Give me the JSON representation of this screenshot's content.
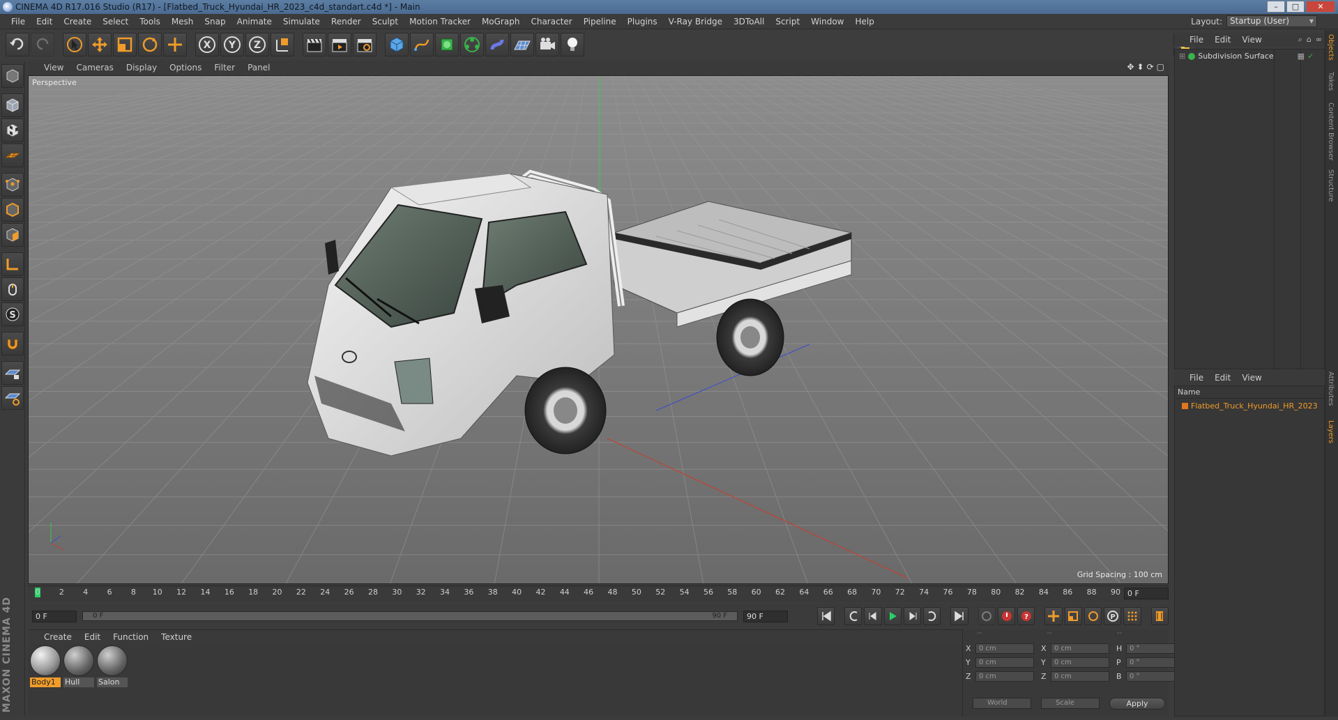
{
  "window": {
    "title": "CINEMA 4D R17.016 Studio (R17) - [Flatbed_Truck_Hyundai_HR_2023_c4d_standart.c4d *] - Main",
    "minimize": "–",
    "maximize": "□",
    "close": "✕"
  },
  "menubar": [
    "File",
    "Edit",
    "Create",
    "Select",
    "Tools",
    "Mesh",
    "Snap",
    "Animate",
    "Simulate",
    "Render",
    "Sculpt",
    "Motion Tracker",
    "MoGraph",
    "Character",
    "Pipeline",
    "Plugins",
    "V-Ray Bridge",
    "3DToAll",
    "Script",
    "Window",
    "Help"
  ],
  "layout": {
    "label": "Layout:",
    "value": "Startup (User)"
  },
  "viewport": {
    "menu": [
      "View",
      "Cameras",
      "Display",
      "Options",
      "Filter",
      "Panel"
    ],
    "label": "Perspective",
    "grid_spacing": "Grid Spacing : 100 cm"
  },
  "timeline": {
    "ticks": [
      "0",
      "2",
      "4",
      "6",
      "8",
      "10",
      "12",
      "14",
      "16",
      "18",
      "20",
      "22",
      "24",
      "26",
      "28",
      "30",
      "32",
      "34",
      "36",
      "38",
      "40",
      "42",
      "44",
      "46",
      "48",
      "50",
      "52",
      "54",
      "56",
      "58",
      "60",
      "62",
      "64",
      "66",
      "68",
      "70",
      "72",
      "74",
      "76",
      "78",
      "80",
      "82",
      "84",
      "86",
      "88",
      "90"
    ],
    "current_frame": "0 F"
  },
  "transport": {
    "start": "0 F",
    "range_start": "0 F",
    "range_end": "90 F",
    "end": "90 F"
  },
  "materials": {
    "menu": [
      "Create",
      "Edit",
      "Function",
      "Texture"
    ],
    "items": [
      {
        "name": "Body1",
        "selected": true
      },
      {
        "name": "Hull",
        "selected": false
      },
      {
        "name": "Salon",
        "selected": false
      }
    ]
  },
  "coords": {
    "header": [
      "--",
      "--",
      "--"
    ],
    "rows": [
      {
        "a": "X",
        "av": "0 cm",
        "b": "X",
        "bv": "0 cm",
        "c": "H",
        "cv": "0 °"
      },
      {
        "a": "Y",
        "av": "0 cm",
        "b": "Y",
        "bv": "0 cm",
        "c": "P",
        "cv": "0 °"
      },
      {
        "a": "Z",
        "av": "0 cm",
        "b": "Z",
        "bv": "0 cm",
        "c": "B",
        "cv": "0 °"
      }
    ],
    "world": "World",
    "scale": "Scale",
    "apply": "Apply"
  },
  "objects": {
    "menu": [
      "File",
      "Edit",
      "View"
    ],
    "items": [
      {
        "name": "Subdivision Surface"
      }
    ]
  },
  "layers": {
    "menu": [
      "File",
      "Edit",
      "View"
    ],
    "header": "Name",
    "items": [
      {
        "name": "Flatbed_Truck_Hyundai_HR_2023"
      }
    ]
  },
  "side_tabs": [
    "Objects",
    "Takes",
    "Content Browser",
    "Structure",
    "Attributes",
    "Layers"
  ],
  "brand": "MAXON CINEMA 4D",
  "colors": {
    "accent": "#f09c2a",
    "playhead": "#27d067",
    "viewport_bg": "#7a7a7a"
  }
}
